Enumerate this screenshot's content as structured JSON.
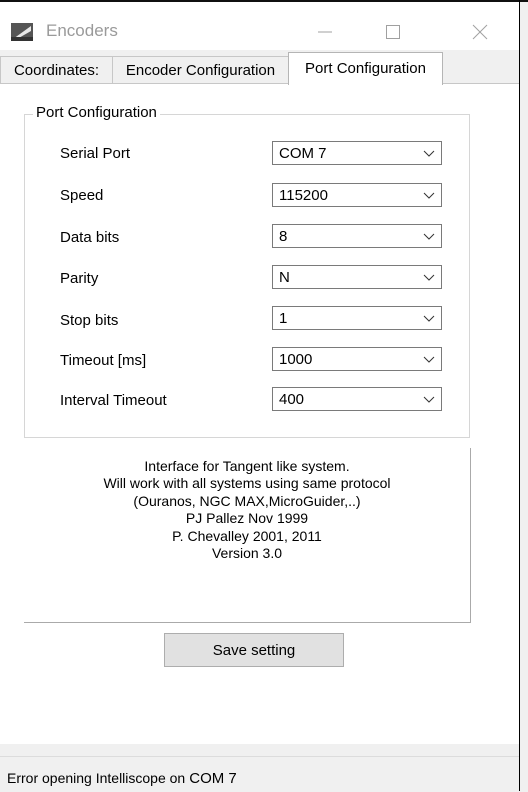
{
  "window": {
    "title": "Encoders"
  },
  "tabs": [
    {
      "label": "Coordinates:"
    },
    {
      "label": "Encoder Configuration"
    },
    {
      "label": "Port Configuration"
    }
  ],
  "port_config": {
    "group_title": "Port Configuration",
    "fields": [
      {
        "label": "Serial Port",
        "value": "COM 7"
      },
      {
        "label": "Speed",
        "value": "115200"
      },
      {
        "label": "Data bits",
        "value": "8"
      },
      {
        "label": "Parity",
        "value": "N"
      },
      {
        "label": "Stop bits",
        "value": "1"
      },
      {
        "label": "Timeout [ms]",
        "value": "1000"
      },
      {
        "label": "Interval Timeout",
        "value": "400"
      }
    ]
  },
  "info": {
    "lines": [
      "Interface for Tangent like system.",
      "Will work with all systems using same protocol",
      "(Ouranos, NGC MAX,MicroGuider,..)",
      "PJ Pallez Nov 1999",
      "P. Chevalley 2001, 2011",
      "Version 3.0"
    ]
  },
  "save_button": {
    "label": "Save setting"
  },
  "status": {
    "text": "Error opening Intelliscope on",
    "port": "COM 7"
  },
  "icons": {
    "app": "telescope-app-icon",
    "minimize": "minimize-icon",
    "maximize": "maximize-icon",
    "close": "close-icon",
    "dropdown": "chevron-down-icon"
  }
}
